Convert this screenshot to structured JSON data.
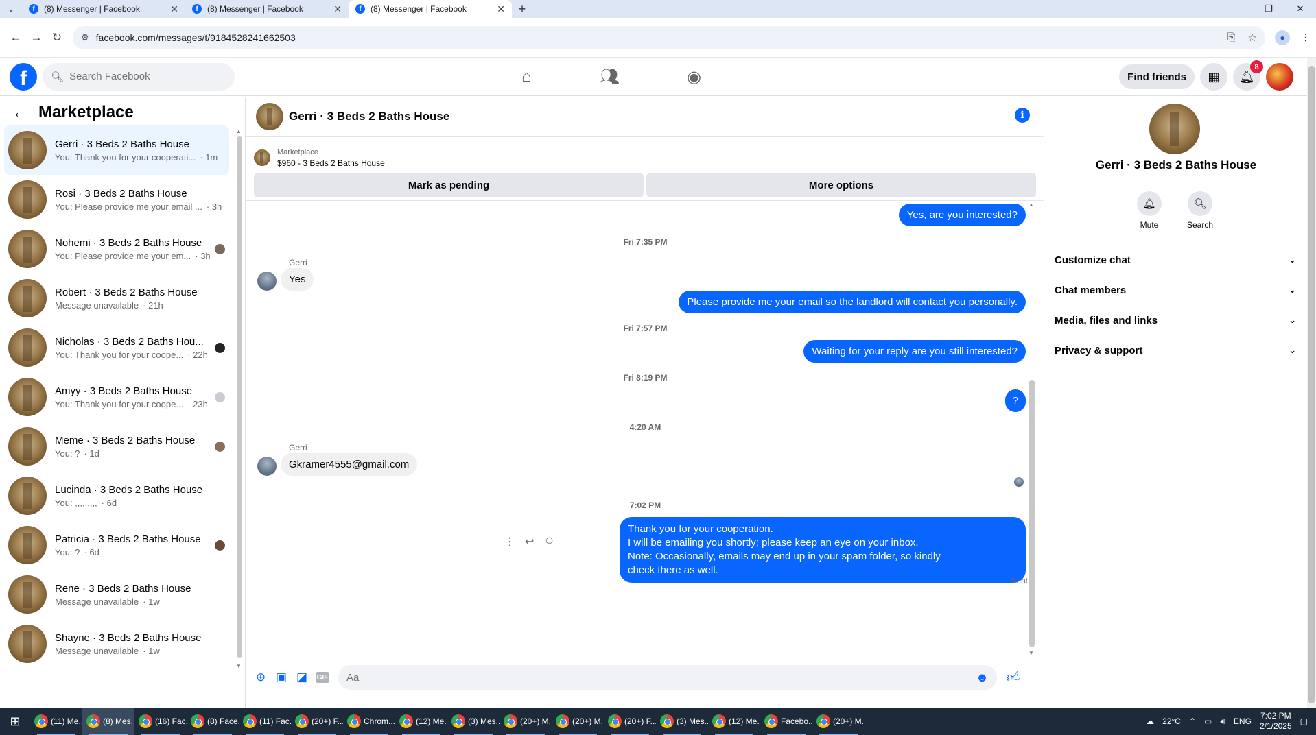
{
  "browser": {
    "tabs": [
      {
        "title": "(8) Messenger | Facebook"
      },
      {
        "title": "(8) Messenger | Facebook"
      },
      {
        "title": "(8) Messenger | Facebook"
      }
    ],
    "url": "facebook.com/messages/t/9184528241662503"
  },
  "header": {
    "search_placeholder": "Search Facebook",
    "find_friends": "Find friends",
    "notifications_count": "8"
  },
  "sidebar": {
    "title": "Marketplace",
    "conversations": [
      {
        "name": "Gerri · 3 Beds 2 Baths House",
        "preview": "You: Thank you for your cooperati...",
        "time": "1m"
      },
      {
        "name": "Rosi · 3 Beds 2 Baths House",
        "preview": "You: Please provide me your email ...",
        "time": "3h"
      },
      {
        "name": "Nohemi · 3 Beds 2 Baths House",
        "preview": "You: Please provide me your em...",
        "time": "3h"
      },
      {
        "name": "Robert · 3 Beds 2 Baths House",
        "preview": "Message unavailable",
        "time": "21h"
      },
      {
        "name": "Nicholas · 3 Beds 2 Baths Hou...",
        "preview": "You: Thank you for your coope...",
        "time": "22h"
      },
      {
        "name": "Amyy · 3 Beds 2 Baths House",
        "preview": "You: Thank you for your coope...",
        "time": "23h"
      },
      {
        "name": "Meme · 3 Beds 2 Baths House",
        "preview": "You: ?",
        "time": "1d"
      },
      {
        "name": "Lucinda · 3 Beds 2 Baths House",
        "preview": "You: ,,,,,,,,,",
        "time": "6d"
      },
      {
        "name": "Patricia · 3 Beds 2 Baths House",
        "preview": "You: ?",
        "time": "6d"
      },
      {
        "name": "Rene · 3 Beds 2 Baths House",
        "preview": "Message unavailable",
        "time": "1w"
      },
      {
        "name": "Shayne · 3 Beds 2 Baths House",
        "preview": "Message unavailable",
        "time": "1w"
      }
    ]
  },
  "chat": {
    "title": "Gerri · 3 Beds 2 Baths House",
    "marketplace_label": "Marketplace",
    "listing": "$960 - 3 Beds 2 Baths House",
    "mark_pending": "Mark as pending",
    "more_options": "More options",
    "messages": {
      "out1": "Yes, are you interested?",
      "ts1": "Fri 7:35 PM",
      "sender1": "Gerri",
      "in1": "Yes",
      "out2": "Please provide me your email so the landlord will contact you personally.",
      "ts2": "Fri 7:57 PM",
      "out3": "Waiting for your reply are you still interested?",
      "ts3": "Fri 8:19 PM",
      "out4": "?",
      "ts4": "4:20 AM",
      "sender2": "Gerri",
      "in2": "Gkramer4555@gmail.com",
      "ts5": "7:02 PM",
      "last_lines": [
        "Thank you for your cooperation.",
        "I will be emailing you shortly; please keep an eye on your inbox.",
        "Note: Occasionally, emails may end up in your spam folder, so kindly",
        "check there as well."
      ],
      "status": "Sent"
    },
    "composer_placeholder": "Aa"
  },
  "right_panel": {
    "name": "Gerri · 3 Beds 2 Baths House",
    "mute": "Mute",
    "search": "Search",
    "sections": [
      "Customize chat",
      "Chat members",
      "Media, files and links",
      "Privacy & support"
    ]
  },
  "taskbar": {
    "items": [
      "(11) Me...",
      "(8) Mes...",
      "(16) Fac...",
      "(8) Face...",
      "(11) Fac...",
      "(20+) F...",
      "Chrom...",
      "(12) Me...",
      "(3) Mes...",
      "(20+) M...",
      "(20+) M...",
      "(20+) F...",
      "(3) Mes...",
      "(12) Me...",
      "Facebo...",
      "(20+) M..."
    ],
    "weather": "22°C",
    "lang": "ENG",
    "time": "7:02 PM",
    "date": "2/1/2025"
  },
  "colors": {
    "accent": "#0866ff",
    "bubble_in": "#f0f0f0",
    "active_conv": "#ebf5ff"
  }
}
